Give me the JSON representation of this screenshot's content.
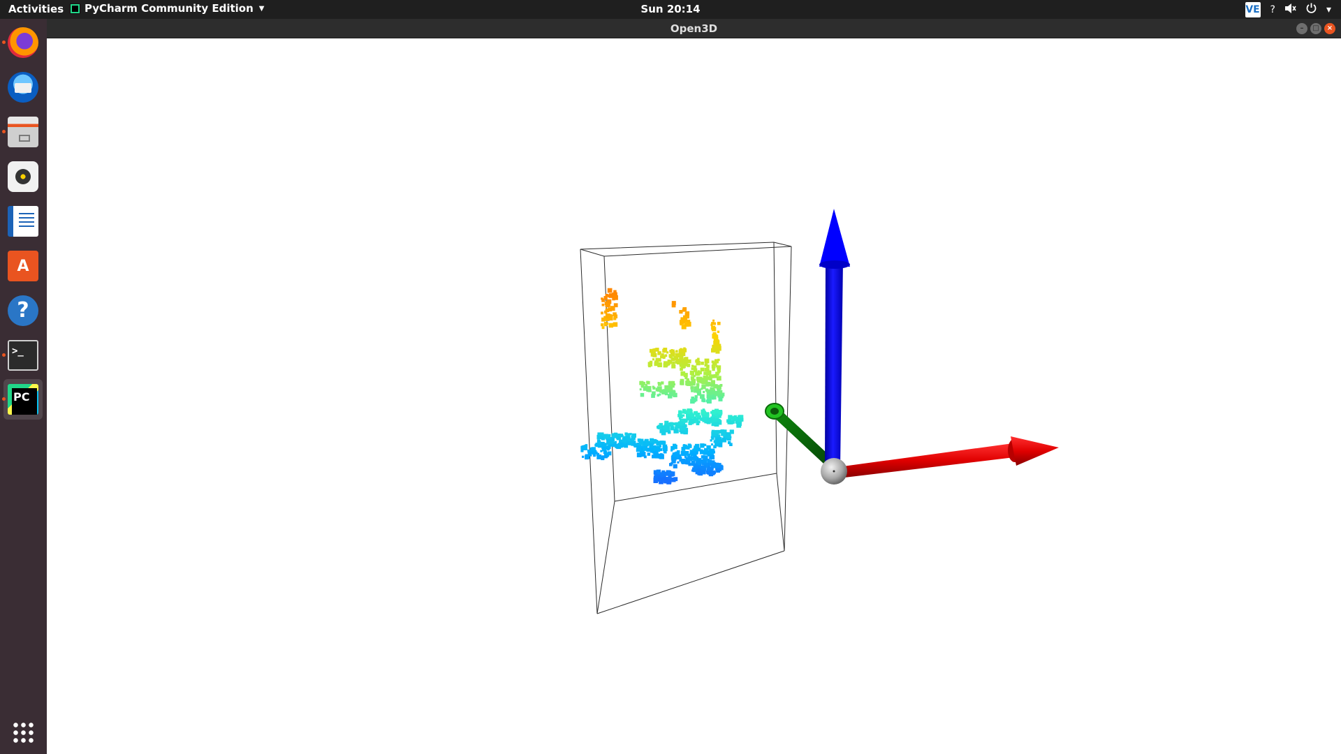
{
  "topbar": {
    "activities": "Activities",
    "app_name": "PyCharm Community Edition",
    "clock": "Sun 20:14",
    "tray": {
      "ve_label": "VE",
      "help_symbol": "?",
      "sound_icon": "speaker-muted-icon",
      "power_icon": "power-icon",
      "menu_arrow": "▾"
    }
  },
  "window": {
    "title": "Open3D",
    "controls": [
      "minimize",
      "maximize",
      "close"
    ]
  },
  "dock": {
    "items": [
      {
        "name": "firefox",
        "icon": "firefox-icon",
        "running": true
      },
      {
        "name": "thunderbird",
        "icon": "thunderbird-icon",
        "running": false
      },
      {
        "name": "files",
        "icon": "files-icon",
        "running": true
      },
      {
        "name": "rhythmbox",
        "icon": "rhythmbox-icon",
        "running": false
      },
      {
        "name": "libreoffice-writer",
        "icon": "writer-icon",
        "running": false
      },
      {
        "name": "ubuntu-software",
        "icon": "software-icon",
        "running": false
      },
      {
        "name": "help",
        "icon": "help-icon",
        "running": false
      },
      {
        "name": "terminal",
        "icon": "terminal-icon",
        "running": true
      },
      {
        "name": "pycharm",
        "icon": "pycharm-icon",
        "running": true,
        "active": true
      }
    ],
    "show_apps_icon": "apps-grid-icon"
  },
  "scene": {
    "axis_colors": {
      "x": "#e00000",
      "y": "#0a7a0a",
      "z": "#0000f0",
      "origin": "#a8a8a8"
    },
    "cloud_colormap": [
      "#1e5aff",
      "#00b0ff",
      "#30f0d0",
      "#b0f040",
      "#ffd000",
      "#ff8800"
    ]
  }
}
